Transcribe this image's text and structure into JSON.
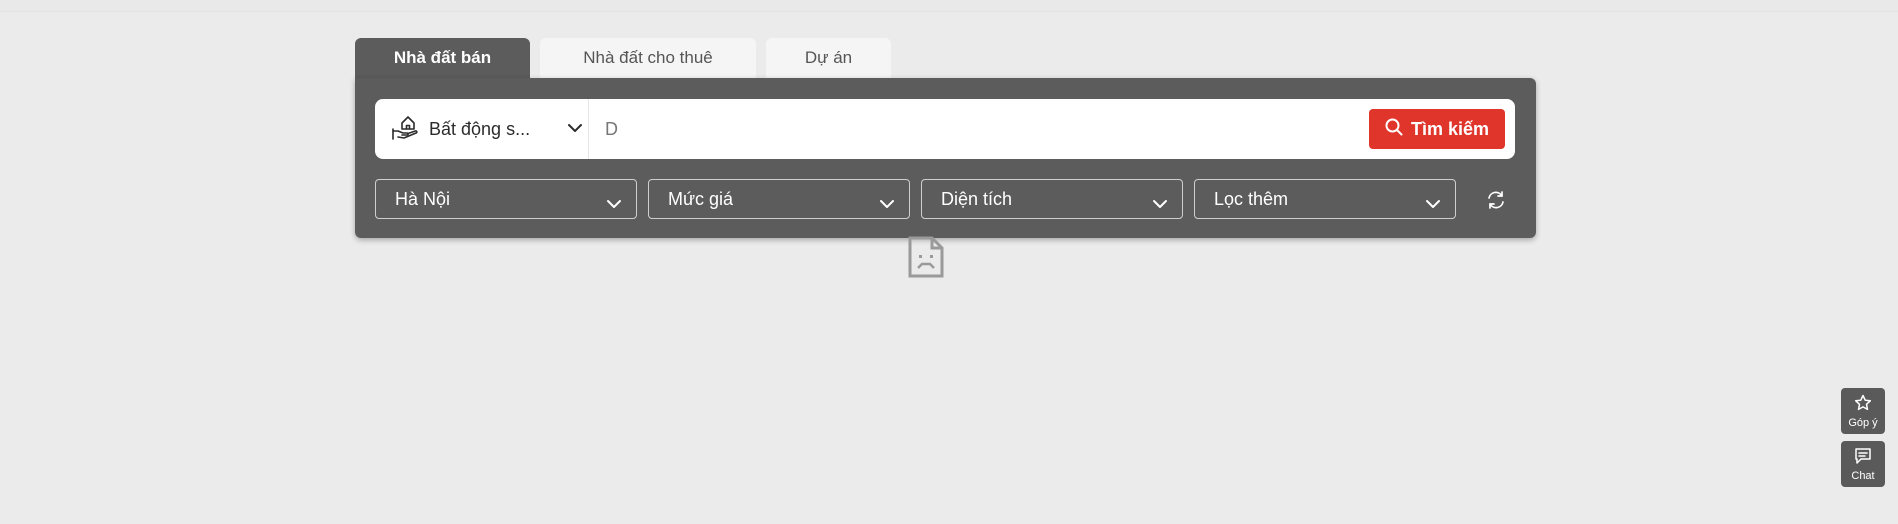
{
  "tabs": [
    {
      "label": "Nhà đất bán",
      "active": true
    },
    {
      "label": "Nhà đất cho thuê",
      "active": false
    },
    {
      "label": "Dự án",
      "active": false
    }
  ],
  "search": {
    "type_label": "Bất động s...",
    "input_value": "D",
    "button_label": "Tìm kiếm"
  },
  "filters": [
    {
      "label": "Hà Nội"
    },
    {
      "label": "Mức giá"
    },
    {
      "label": "Diện tích"
    },
    {
      "label": "Lọc thêm"
    }
  ],
  "floating": {
    "feedback_label": "Góp ý",
    "chat_label": "Chat"
  },
  "icons": [
    "house-hand-icon",
    "chevron-down-icon",
    "search-icon",
    "refresh-icon",
    "broken-image-icon",
    "star-icon",
    "chat-icon"
  ],
  "colors": {
    "accent": "#e0352b",
    "panel": "#5c5c5c",
    "background": "#ebebeb"
  }
}
